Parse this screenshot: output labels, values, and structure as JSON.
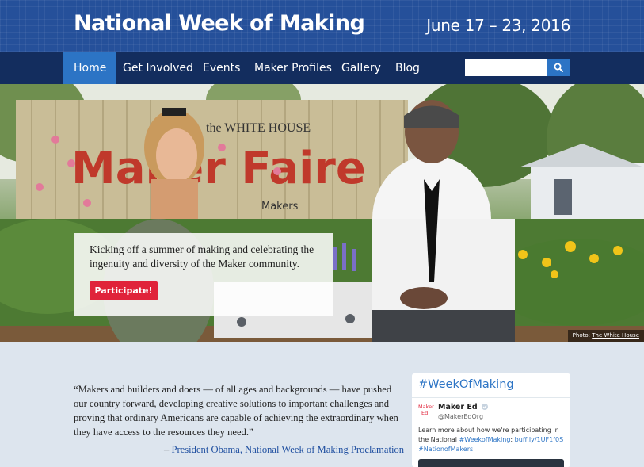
{
  "header": {
    "title": "National Week of Making",
    "dates": "June 17 – 23, 2016"
  },
  "nav": {
    "items": [
      {
        "label": "Home",
        "active": true
      },
      {
        "label": "Get Involved"
      },
      {
        "label": "Events"
      },
      {
        "label": "Maker Profiles"
      },
      {
        "label": "Gallery"
      },
      {
        "label": "Blog"
      }
    ],
    "search": {
      "value": "",
      "placeholder": ""
    }
  },
  "hero": {
    "message": "Kicking off a summer of making and celebrating the ingenuity and diversity of the Maker community.",
    "cta_label": "Participate!",
    "credit_prefix": "Photo: ",
    "credit_source": "The White House",
    "sign_top": "the WHITE HOUSE",
    "sign_main": "Maker Faire",
    "sign_bottom": "Makers"
  },
  "quote": {
    "text": "“Makers and builders and doers — of all ages and backgrounds — have pushed our country forward, developing creative solutions to important challenges and proving that ordinary Americans are capable of achieving the extraordinary when they have access to the resources they need.”",
    "dash": "– ",
    "attribution_link": "President Obama, National Week of Making Proclamation"
  },
  "twitter": {
    "hashtag": "#WeekOfMaking",
    "avatar_line1": "Maker",
    "avatar_line2": "Ed",
    "name": "Maker Ed",
    "handle": "@MakerEdOrg",
    "body_prefix": "Learn more about how we're participating in the National ",
    "body_hashtag": "#WeekofMaking",
    "body_sep": ": ",
    "body_link": "buff.ly/1UF1f0S",
    "body_hashtag2": "#NationofMakers"
  },
  "colors": {
    "header_bg": "#25509a",
    "nav_bg": "#132d5e",
    "nav_active": "#2c74c5",
    "cta": "#e0233a",
    "page_bg": "#dde5ee"
  },
  "icons": [
    "search-icon",
    "verified-icon"
  ]
}
